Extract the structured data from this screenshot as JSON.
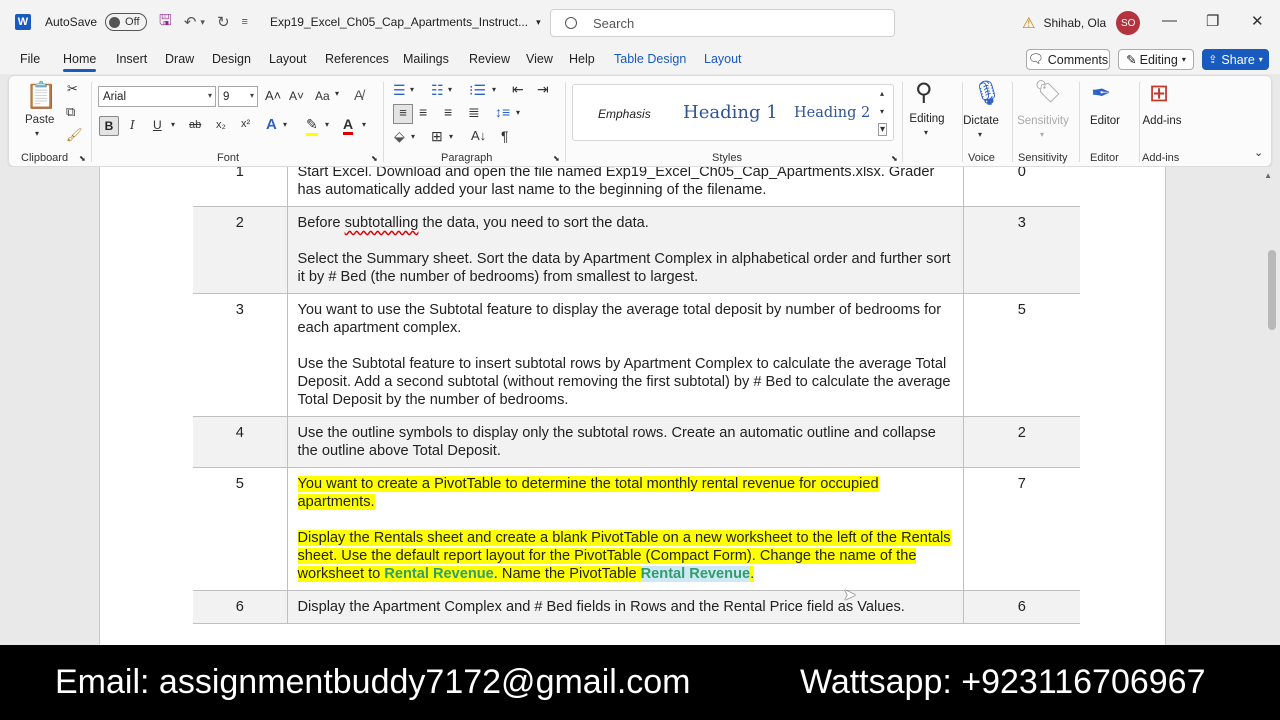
{
  "titlebar": {
    "app_icon": "W",
    "autosave_label": "AutoSave",
    "autosave_state": "Off",
    "document_title": "Exp19_Excel_Ch05_Cap_Apartments_Instruct...",
    "search_placeholder": "Search",
    "user_name": "Shihab, Ola",
    "user_initials": "SO"
  },
  "menu": {
    "tabs": [
      "File",
      "Home",
      "Insert",
      "Draw",
      "Design",
      "Layout",
      "References",
      "Mailings",
      "Review",
      "View",
      "Help",
      "Table Design",
      "Layout"
    ],
    "comments_label": "Comments",
    "editing_label": "Editing",
    "share_label": "Share"
  },
  "ribbon": {
    "clipboard": {
      "paste_label": "Paste",
      "group_label": "Clipboard"
    },
    "font": {
      "font_name": "Arial",
      "font_size": "9",
      "group_label": "Font",
      "bold": "B",
      "italic": "I",
      "underline": "U",
      "strike": "ab",
      "subscript": "x₂",
      "superscript": "x²",
      "case": "Aa"
    },
    "paragraph": {
      "group_label": "Paragraph"
    },
    "styles": {
      "items": [
        "Emphasis",
        "Heading 1",
        "Heading 2"
      ],
      "group_label": "Styles"
    },
    "editing": {
      "label": "Editing"
    },
    "voice": {
      "dictate_label": "Dictate",
      "group_label": "Voice"
    },
    "sensitivity": {
      "label": "Sensitivity",
      "group_label": "Sensitivity"
    },
    "editor": {
      "label": "Editor",
      "group_label": "Editor"
    },
    "addins": {
      "label": "Add-ins",
      "group_label": "Add-ins"
    }
  },
  "document": {
    "rows": [
      {
        "num": "1",
        "p1": "Start Excel. Download and open the file named Exp19_Excel_Ch05_Cap_Apartments.xlsx. Grader has automatically added your last name to the beginning of the filename.",
        "p2": "",
        "points": "0"
      },
      {
        "num": "2",
        "p1_pre": "Before ",
        "p1_squig": "subtotalling",
        "p1_post": " the data, you need to sort the data.",
        "p2": "Select the Summary sheet. Sort the data by Apartment Complex in alphabetical order and further sort it by # Bed (the number of bedrooms) from smallest to largest.",
        "points": "3"
      },
      {
        "num": "3",
        "p1": "You want to use the Subtotal feature to display the average total deposit by number of bedrooms for each apartment complex.",
        "p2": "Use the Subtotal feature to insert subtotal rows by Apartment Complex to calculate the average Total Deposit. Add a second subtotal (without removing the first subtotal) by # Bed to calculate the average Total Deposit by the number of bedrooms.",
        "points": "5"
      },
      {
        "num": "4",
        "p1": "Use the outline symbols to display only the subtotal rows. Create an automatic outline and collapse the outline above Total Deposit.",
        "p2": "",
        "points": "2"
      },
      {
        "num": "5",
        "p1": "You want to create a PivotTable to determine the total monthly rental revenue for occupied apartments.",
        "p2_a": "Display the Rentals sheet and create a blank PivotTable on a new worksheet to the left of the Rentals sheet. Use the default report layout for the PivotTable (Compact Form). Change the name of the worksheet to ",
        "p2_b": "Rental Revenue",
        "p2_c": ". Name the PivotTable ",
        "p2_d": "Rental Revenue",
        "p2_e": ".",
        "points": "7"
      },
      {
        "num": "6",
        "p1": "Display the Apartment Complex and # Bed fields in Rows and the Rental Price field as Values.",
        "p2": "",
        "points": "6"
      }
    ]
  },
  "banner": {
    "email": "Email:  assignmentbuddy7172@gmail.com",
    "whatsapp": "Wattsapp: +923116706967"
  },
  "colors": {
    "accent": "#185abd",
    "highlight": "#ffff00",
    "green_text": "#2e9f6b",
    "banner_bg": "#000000"
  }
}
